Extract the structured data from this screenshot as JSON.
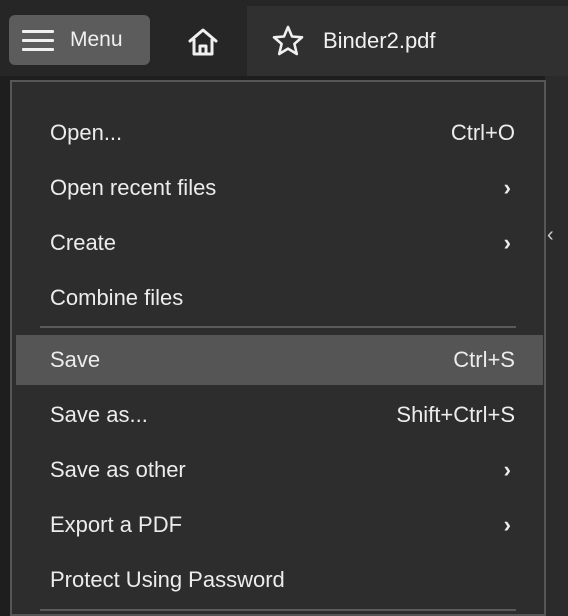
{
  "topbar": {
    "menu_label": "Menu",
    "tab_label": "Binder2.pdf"
  },
  "menu": {
    "items": [
      {
        "label": "Open...",
        "shortcut": "Ctrl+O"
      },
      {
        "label": "Open recent files",
        "submenu": "›"
      },
      {
        "label": "Create",
        "submenu": "›"
      },
      {
        "label": "Combine files"
      },
      {
        "label": "Save",
        "shortcut": "Ctrl+S",
        "highlighted": true
      },
      {
        "label": "Save as...",
        "shortcut": "Shift+Ctrl+S"
      },
      {
        "label": "Save as other",
        "submenu": "›"
      },
      {
        "label": "Export a PDF",
        "submenu": "›"
      },
      {
        "label": "Protect Using Password"
      }
    ]
  },
  "background": {
    "collapse_chevron": "‹"
  },
  "colors": {
    "menu_bg": "#2d2d2d",
    "highlight": "#555555",
    "menu_button": "#5c5c5c"
  }
}
